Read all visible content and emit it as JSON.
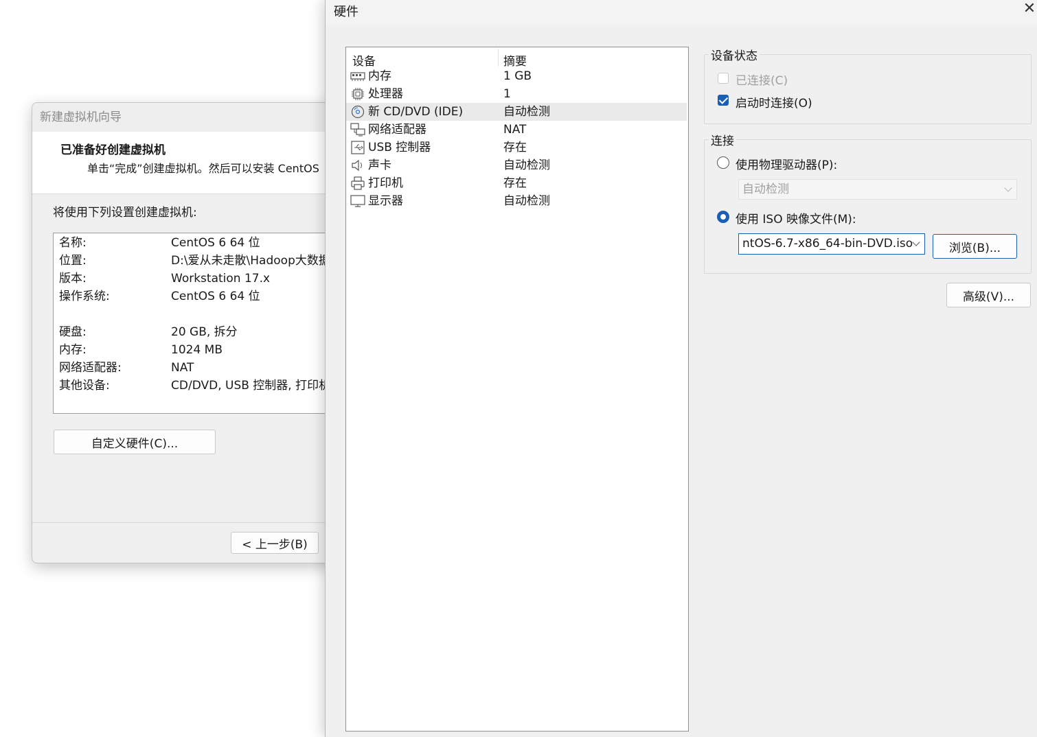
{
  "wizard": {
    "title": "新建虚拟机向导",
    "header_title": "已准备好创建虚拟机",
    "header_subtitle": "单击“完成”创建虚拟机。然后可以安装 CentOS",
    "lead": "将使用下列设置创建虚拟机:",
    "summary": [
      {
        "label": "名称:",
        "value": "CentOS 6 64 位"
      },
      {
        "label": "位置:",
        "value": "D:\\爱从未走散\\Hadoop大数据"
      },
      {
        "label": "版本:",
        "value": "Workstation 17.x"
      },
      {
        "label": "操作系统:",
        "value": "CentOS 6 64 位"
      },
      {
        "label": "硬盘:",
        "value": "20 GB, 拆分"
      },
      {
        "label": "内存:",
        "value": "1024 MB"
      },
      {
        "label": "网络适配器:",
        "value": "NAT"
      },
      {
        "label": "其他设备:",
        "value": "CD/DVD, USB 控制器, 打印机"
      }
    ],
    "customize_button": "自定义硬件(C)...",
    "back_button": "< 上一步(B)"
  },
  "hardware": {
    "title": "硬件",
    "close_glyph": "✕",
    "columns": {
      "device": "设备",
      "summary": "摘要"
    },
    "devices": [
      {
        "icon": "memory-icon",
        "name": "内存",
        "summary": "1 GB"
      },
      {
        "icon": "processor-icon",
        "name": "处理器",
        "summary": "1"
      },
      {
        "icon": "cd-dvd-icon",
        "name": "新 CD/DVD (IDE)",
        "summary": "自动检测"
      },
      {
        "icon": "network-adapter-icon",
        "name": "网络适配器",
        "summary": "NAT"
      },
      {
        "icon": "usb-icon",
        "name": "USB 控制器",
        "summary": "存在"
      },
      {
        "icon": "sound-card-icon",
        "name": "声卡",
        "summary": "自动检测"
      },
      {
        "icon": "printer-icon",
        "name": "打印机",
        "summary": "存在"
      },
      {
        "icon": "display-icon",
        "name": "显示器",
        "summary": "自动检测"
      }
    ],
    "selected_device_index": 2,
    "device_status": {
      "title": "设备状态",
      "connected": {
        "label": "已连接(C)",
        "checked": false,
        "enabled": false
      },
      "connect_at_power_on": {
        "label": "启动时连接(O)",
        "checked": true,
        "enabled": true
      }
    },
    "connection": {
      "title": "连接",
      "physical": {
        "label": "使用物理驱动器(P):",
        "selected": false,
        "drive_value": "自动检测"
      },
      "iso": {
        "label": "使用 ISO 映像文件(M):",
        "selected": true,
        "file_value": "ntOS-6.7-x86_64-bin-DVD.iso",
        "browse_button": "浏览(B)..."
      }
    },
    "advanced_button": "高级(V)...",
    "accent_color": "#1a5fb4"
  }
}
